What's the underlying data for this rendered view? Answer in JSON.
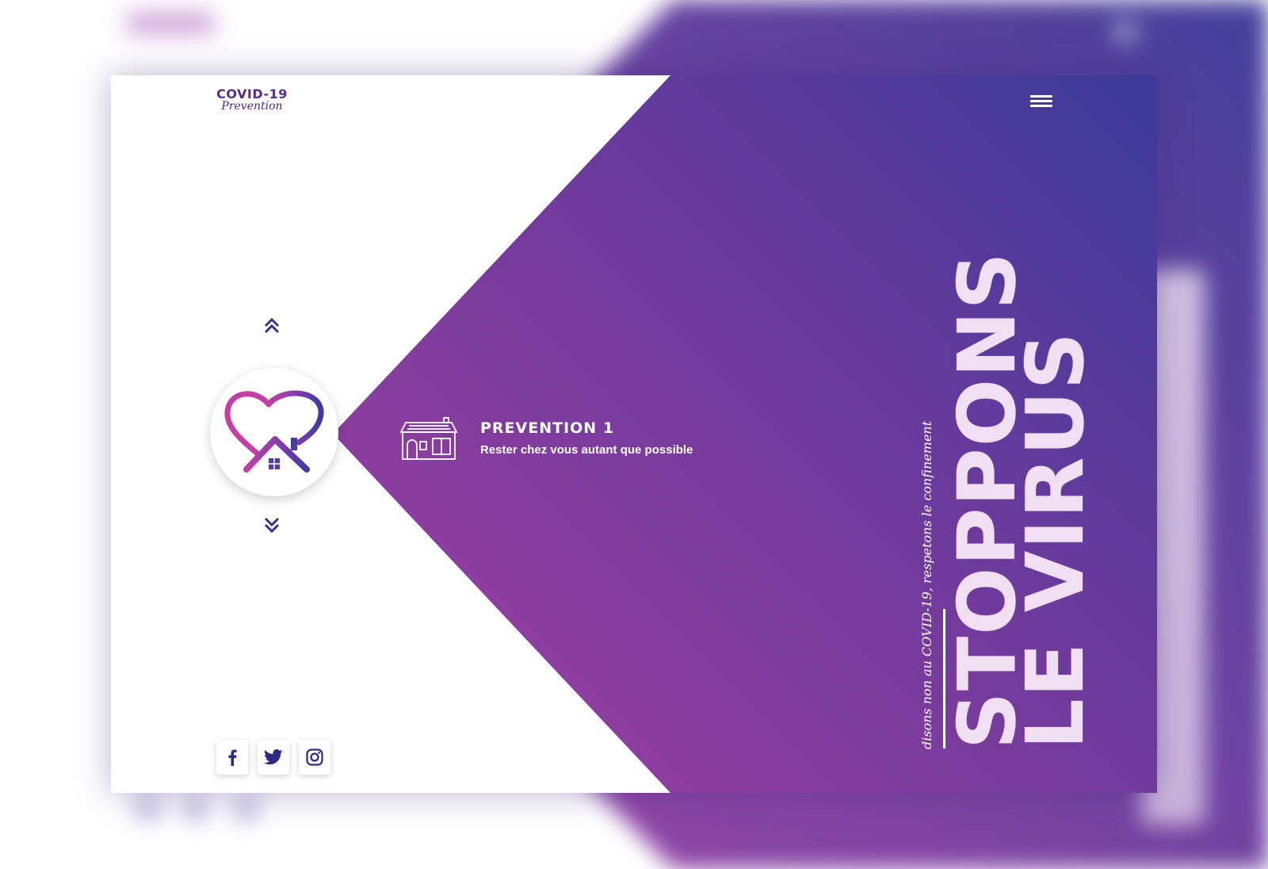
{
  "logo": {
    "line1": "COVID-19",
    "line2": "Prevention"
  },
  "prevention": {
    "title": "PREVENTION 1",
    "subtitle": "Rester chez vous autant que possible"
  },
  "hero": {
    "line1": "STOPPONS",
    "line2": "LE VIRUS",
    "tagline": "disons non au COVID-19, respetons le confinement"
  },
  "social": [
    "facebook-icon",
    "twitter-icon",
    "instagram-icon"
  ],
  "colors": {
    "accent_purple": "#a13fa4",
    "accent_blue": "#3a3a9a",
    "brand_dark": "#3a2f92",
    "hero_text": "#f1e0f3"
  }
}
